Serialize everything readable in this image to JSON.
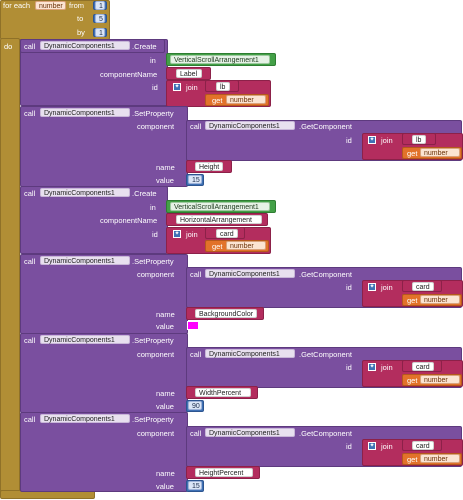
{
  "loop": {
    "for_each": "for each",
    "var": "number",
    "from": "from",
    "to": "to",
    "by": "by",
    "do": "do",
    "from_val": "1",
    "to_val": "5",
    "by_val": "1"
  },
  "kw": {
    "call": "call",
    "in": "in",
    "componentName": "componentName",
    "id": "id",
    "component": "component",
    "name": "name",
    "value": "value",
    "join": "join",
    "get": "get"
  },
  "blocks": {
    "b1": {
      "comp": "DynamicComponents1",
      "method": ".Create",
      "in": "VerticalScrollArrangement1",
      "cname": "Label",
      "join1": "lb",
      "get": "number"
    },
    "b2": {
      "comp": "DynamicComponents1",
      "method": ".SetProperty",
      "get_comp": "DynamicComponents1",
      "get_method": ".GetComponent",
      "join1": "lb",
      "get": "number",
      "name": "Height",
      "value": "15"
    },
    "b3": {
      "comp": "DynamicComponents1",
      "method": ".Create",
      "in": "VerticalScrollArrangement1",
      "cname": "HorizontalArrangement",
      "join1": "card",
      "get": "number"
    },
    "b4": {
      "comp": "DynamicComponents1",
      "method": ".SetProperty",
      "get_comp": "DynamicComponents1",
      "get_method": ".GetComponent",
      "join1": "card",
      "get": "number",
      "name": "BackgroundColor",
      "color": "#ff00ff"
    },
    "b5": {
      "comp": "DynamicComponents1",
      "method": ".SetProperty",
      "get_comp": "DynamicComponents1",
      "get_method": ".GetComponent",
      "join1": "card",
      "get": "number",
      "name": "WidthPercent",
      "value": "90"
    },
    "b6": {
      "comp": "DynamicComponents1",
      "method": ".SetProperty",
      "get_comp": "DynamicComponents1",
      "get_method": ".GetComponent",
      "join1": "card",
      "get": "number",
      "name": "HeightPercent",
      "value": "15"
    }
  },
  "colors": {
    "loop": "#b18e35",
    "component": "#7a4f9f",
    "text": "#b32d5e",
    "math": "#3f71b5",
    "variable": "#e2722a",
    "component_ref": "#43a047"
  }
}
